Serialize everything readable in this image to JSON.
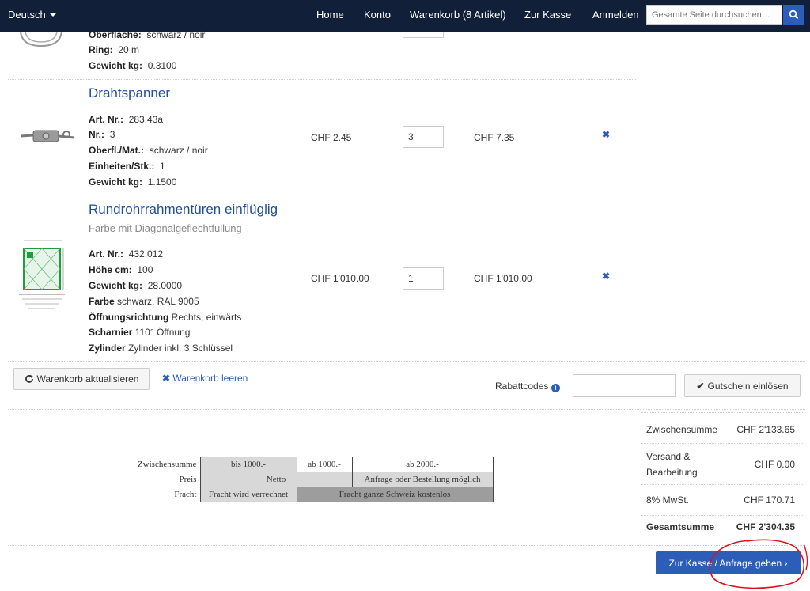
{
  "nav": {
    "language": "Deutsch",
    "home": "Home",
    "account": "Konto",
    "cart": "Warenkorb (8 Artikel)",
    "checkout": "Zur Kasse",
    "login": "Anmelden",
    "search_placeholder": "Gesamte Seite durchsuchen…"
  },
  "cart": {
    "item0": {
      "attrs": [
        {
          "label": "Oberfläche:",
          "value": "schwarz / noir"
        },
        {
          "label": "Ring:",
          "value": "20 m"
        },
        {
          "label": "Gewicht kg:",
          "value": "0.3100"
        }
      ]
    },
    "item1": {
      "name": "Drahtspanner",
      "attrs": [
        {
          "label": "Art. Nr.:",
          "value": "283.43a"
        },
        {
          "label": "Nr.:",
          "value": "3"
        },
        {
          "label": "Oberfl./Mat.:",
          "value": "schwarz / noir"
        },
        {
          "label": "Einheiten/Stk.:",
          "value": "1"
        },
        {
          "label": "Gewicht kg:",
          "value": "1.1500"
        }
      ],
      "price": "CHF 2.45",
      "qty": "3",
      "total": "CHF 7.35"
    },
    "item2": {
      "name": "Rundrohrrahmentüren einflüglig",
      "subtitle": "Farbe mit Diagonalgeflechtfüllung",
      "attrs": [
        {
          "label": "Art. Nr.:",
          "value": "432.012"
        },
        {
          "label": "Höhe cm:",
          "value": "100"
        },
        {
          "label": "Gewicht kg:",
          "value": "28.0000"
        },
        {
          "label": "Farbe",
          "value": "schwarz, RAL 9005"
        },
        {
          "label": "Öffnungsrichtung",
          "value": "Rechts, einwärts"
        },
        {
          "label": "Scharnier",
          "value": "110° Öffnung"
        },
        {
          "label": "Zylinder",
          "value": "Zylinder inkl. 3 Schlüssel"
        }
      ],
      "price": "CHF 1'010.00",
      "qty": "1",
      "total": "CHF 1'010.00"
    },
    "remove_symbol": "✖"
  },
  "actions": {
    "update": "Warenkorb aktualisieren",
    "clear": "Warenkorb leeren",
    "discount_label": "Rabattcodes",
    "redeem": "Gutschein einlösen"
  },
  "freight": {
    "header_label": "Zwischensumme",
    "cols": [
      "bis 1000.-",
      "ab 1000.-",
      "ab 2000.-"
    ],
    "price_label": "Preis",
    "price_netto": "Netto",
    "price_request": "Anfrage oder Bestellung möglich",
    "freight_label": "Fracht",
    "freight_charged": "Fracht wird verrechnet",
    "freight_free": "Fracht ganze Schweiz kostenlos"
  },
  "summary": {
    "subtotal_label": "Zwischensumme",
    "subtotal": "CHF 2'133.65",
    "shipping_label_1": "Versand &",
    "shipping_label_2": "Bearbeitung",
    "shipping": "CHF 0.00",
    "vat_label": "8% MwSt.",
    "vat": "CHF 170.71",
    "grand_label": "Gesamtsumme",
    "grand": "CHF 2'304.35"
  },
  "checkout_button": "Zur Kasse / Anfrage gehen ›",
  "colors": {
    "navbar": "#111f38",
    "accent": "#2c5db8",
    "annotation": "#e0101a"
  }
}
